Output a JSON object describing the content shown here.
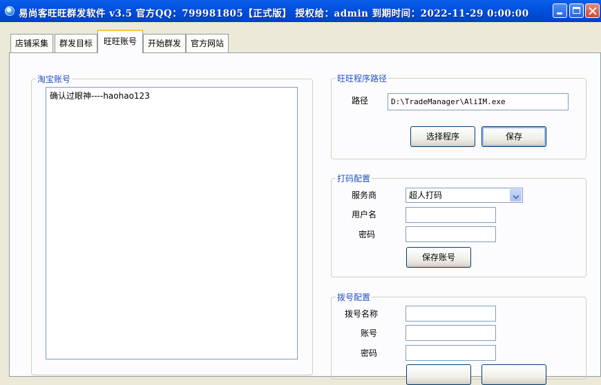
{
  "window": {
    "title": "易尚客旺旺群发软件 v3.5 官方QQ：799981805【正式版】 授权给：admin 到期时间：2022-11-29 0:00:00"
  },
  "tabs": [
    {
      "label": "店铺采集"
    },
    {
      "label": "群发目标"
    },
    {
      "label": "旺旺账号",
      "active": true
    },
    {
      "label": "开始群发"
    },
    {
      "label": "官方网站"
    }
  ],
  "taobao_accounts": {
    "legend": "淘宝账号",
    "items": [
      "确认过眼神----haohao123"
    ]
  },
  "program_path": {
    "legend": "旺旺程序路径",
    "path_label": "路径",
    "path_value": "D:\\TradeManager\\AliIM.exe",
    "select_button": "选择程序",
    "save_button": "保存"
  },
  "captcha": {
    "legend": "打码配置",
    "provider_label": "服务商",
    "provider_value": "超人打码",
    "username_label": "用户名",
    "username_value": "",
    "password_label": "密码",
    "password_value": "",
    "save_button": "保存账号"
  },
  "dialup": {
    "legend": "拨号配置",
    "name_label": "拨号名称",
    "name_value": "",
    "account_label": "账号",
    "account_value": "",
    "password_label": "密码",
    "password_value": ""
  },
  "colors": {
    "legend_text": "#2050c0",
    "titlebar": "#0050e0",
    "active_tab_highlight": "#ffc83c"
  }
}
